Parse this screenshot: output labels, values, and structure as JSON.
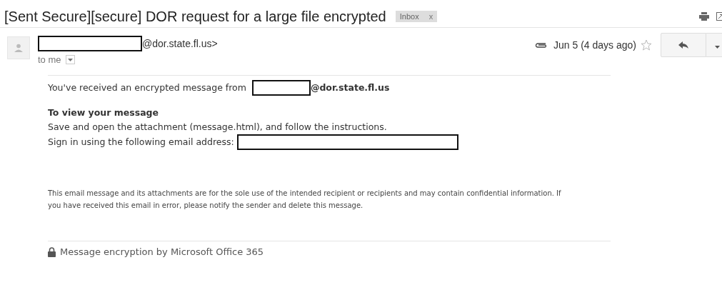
{
  "subject": "[Sent Secure][secure] DOR request for a large file encrypted",
  "label": {
    "text": "Inbox",
    "close": "x"
  },
  "sender": {
    "domain": "@dor.state.fl.us>",
    "to": "to me"
  },
  "date": "Jun 5 (4 days ago)",
  "starred": false,
  "body": {
    "intro": "You've received an encrypted message from",
    "intro_domain": "@dor.state.fl.us",
    "heading": "To view your message",
    "line_1": "Save and open the attachment (message.html), and follow the instructions.",
    "line_2": "Sign in using the following email address:",
    "disclaimer": "This email message and its attachments are for the sole use of the intended recipient or recipients and may contain confidential information. If you have received this email in error, please notify the sender and delete this message.",
    "footer": "Message encryption by Microsoft Office 365"
  }
}
